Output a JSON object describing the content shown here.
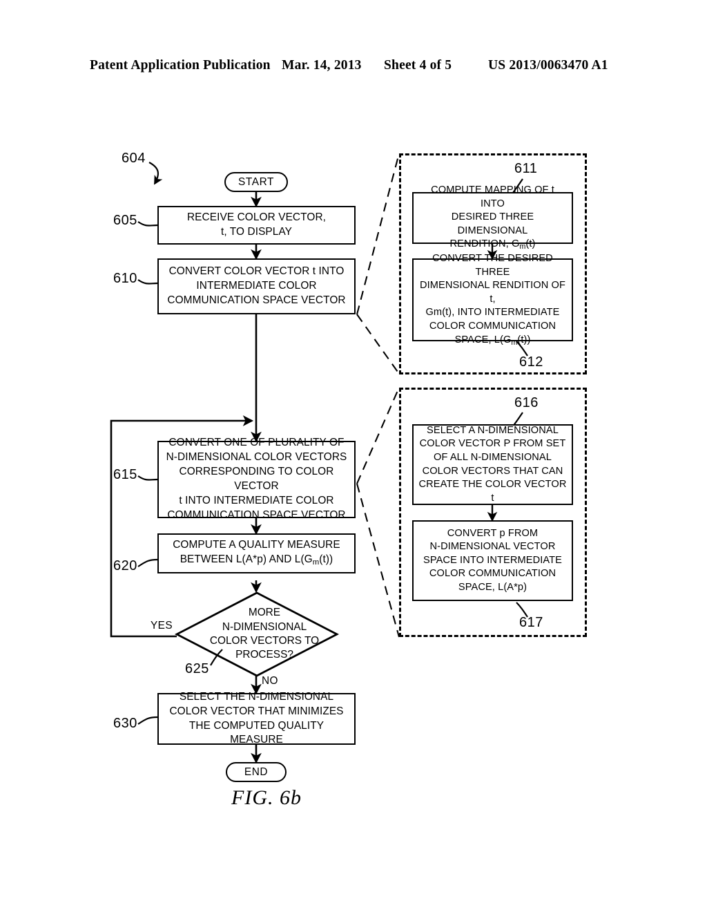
{
  "header": {
    "publication": "Patent Application Publication",
    "date": "Mar. 14, 2013",
    "sheet": "Sheet 4 of 5",
    "number": "US 2013/0063470 A1"
  },
  "figure": {
    "caption": "FIG. 6b",
    "diagram_ref": "604"
  },
  "flowchart": {
    "start_label": "START",
    "end_label": "END",
    "branch_yes": "YES",
    "branch_no": "NO",
    "nodes": [
      {
        "ref": "605",
        "lines": [
          "RECEIVE COLOR VECTOR,",
          "t, TO DISPLAY"
        ]
      },
      {
        "ref": "610",
        "lines": [
          "CONVERT COLOR VECTOR t INTO",
          "INTERMEDIATE COLOR",
          "COMMUNICATION SPACE VECTOR"
        ]
      },
      {
        "ref": "615",
        "lines": [
          "CONVERT ONE OF PLURALITY OF",
          "N-DIMENSIONAL COLOR VECTORS",
          "CORRESPONDING TO COLOR VECTOR",
          "t INTO INTERMEDIATE COLOR",
          "COMMUNICATION SPACE VECTOR"
        ]
      },
      {
        "ref": "620",
        "lines": [
          "COMPUTE A QUALITY MEASURE",
          "BETWEEN L(A*p) AND L(Gm(t))"
        ]
      },
      {
        "ref": "625",
        "lines": [
          "MORE",
          "N-DIMENSIONAL",
          "COLOR VECTORS TO",
          "PROCESS?"
        ]
      },
      {
        "ref": "630",
        "lines": [
          "SELECT THE N-DIMENSIONAL",
          "COLOR VECTOR THAT MINIMIZES",
          "THE COMPUTED QUALITY MEASURE"
        ]
      }
    ]
  },
  "callout_upper": {
    "nodes": [
      {
        "ref": "611",
        "lines": [
          "COMPUTE MAPPING OF t INTO",
          "DESIRED THREE DIMENSIONAL",
          "RENDITION, Gm(t)"
        ]
      },
      {
        "ref": "612",
        "lines": [
          "CONVERT THE DESIRED THREE",
          "DIMENSIONAL RENDITION OF t,",
          "Gm(t), INTO INTERMEDIATE",
          "COLOR COMMUNICATION",
          "SPACE, L(Gm(t))"
        ]
      }
    ]
  },
  "callout_lower": {
    "nodes": [
      {
        "ref": "616",
        "lines": [
          "SELECT A N-DIMENSIONAL",
          "COLOR VECTOR P FROM SET",
          "OF ALL N-DIMENSIONAL",
          "COLOR VECTORS THAT CAN",
          "CREATE THE COLOR VECTOR t"
        ]
      },
      {
        "ref": "617",
        "lines": [
          "CONVERT p FROM",
          "N-DIMENSIONAL VECTOR",
          "SPACE INTO INTERMEDIATE",
          "COLOR COMMUNICATION",
          "SPACE, L(A*p)"
        ]
      }
    ]
  }
}
